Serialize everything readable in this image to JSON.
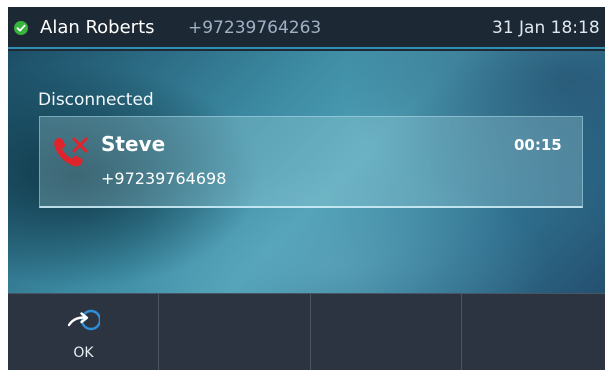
{
  "status_bar": {
    "account_name": "Alan Roberts",
    "account_number": "+97239764263",
    "datetime": "31 Jan 18:18",
    "registration_icon": "check-icon",
    "registration_color": "#38b33d"
  },
  "call": {
    "state": "Disconnected",
    "caller_name": "Steve",
    "caller_number": "+97239764698",
    "duration": "00:15",
    "call_icon": "hangup-icon",
    "call_icon_color": "#e0242b"
  },
  "softkeys": [
    {
      "label": "OK",
      "icon": "transfer-arrow-icon"
    },
    {
      "label": ""
    },
    {
      "label": ""
    },
    {
      "label": ""
    }
  ],
  "colors": {
    "accent": "#2f8fb0",
    "softkey_bg": "#2b3440",
    "status_bg": "#1d2835"
  }
}
